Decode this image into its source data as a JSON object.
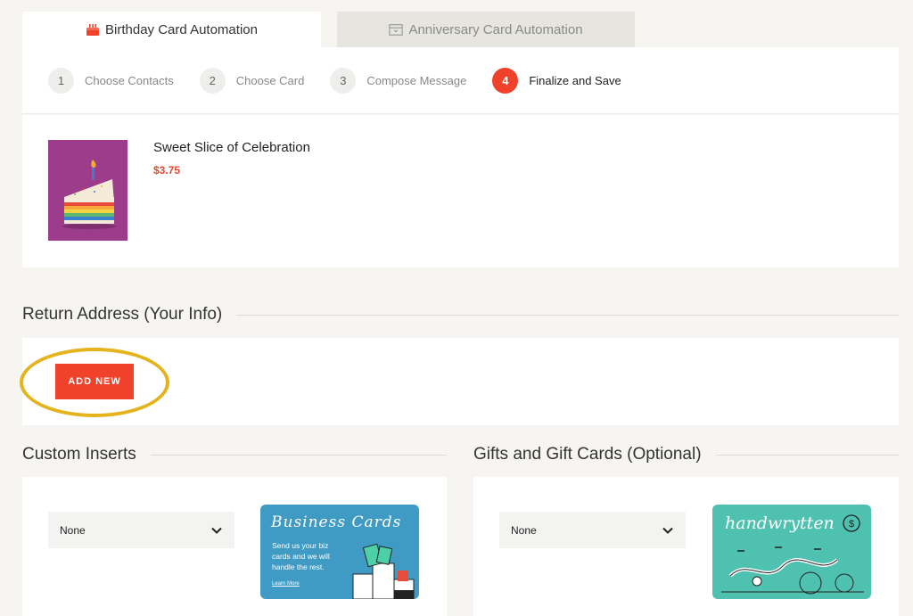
{
  "tabs": [
    {
      "label": "Birthday Card Automation",
      "icon": "cake-icon",
      "active": true
    },
    {
      "label": "Anniversary Card Automation",
      "icon": "calendar-icon",
      "active": false
    }
  ],
  "steps": [
    {
      "number": "1",
      "label": "Choose Contacts"
    },
    {
      "number": "2",
      "label": "Choose Card"
    },
    {
      "number": "3",
      "label": "Compose Message"
    },
    {
      "number": "4",
      "label": "Finalize and Save",
      "active": true
    }
  ],
  "card": {
    "name": "Sweet Slice of Celebration",
    "price": "$3.75"
  },
  "return_address": {
    "heading": "Return Address (Your Info)",
    "add_new_label": "ADD NEW"
  },
  "custom_inserts": {
    "heading": "Custom Inserts",
    "selected": "None",
    "promo": {
      "script_title": "Business Cards",
      "text": "Send us your biz cards and we will handle the rest.",
      "link": "Learn More"
    }
  },
  "gifts": {
    "heading": "Gifts and Gift Cards (Optional)",
    "selected": "None",
    "promo": {
      "logo": "handwrytten"
    }
  },
  "colors": {
    "accent": "#f0412a",
    "highlight": "#e5b31b",
    "background": "#f6f5f1"
  }
}
